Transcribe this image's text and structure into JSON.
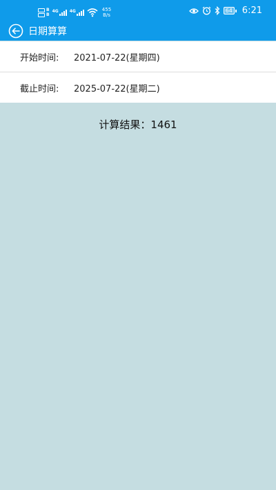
{
  "statusbar": {
    "sim1_label": "B",
    "sim2_label": "B",
    "net1_label": "4G",
    "net2_label": "4G",
    "speed_value": "455",
    "speed_unit": "B/s",
    "battery_level": "64",
    "time": "6:21",
    "icons": [
      "eye-icon",
      "alarm-icon",
      "bluetooth-icon",
      "wifi-icon",
      "battery-icon"
    ]
  },
  "appbar": {
    "title": "日期算算",
    "back_icon": "back-arrow-icon"
  },
  "form": {
    "start_label": "开始时间:",
    "start_value": "2021-07-22(星期四)",
    "end_label": "截止时间:",
    "end_value": "2025-07-22(星期二)"
  },
  "result": {
    "text": "计算结果：1461"
  },
  "colors": {
    "primary": "#0f9bea",
    "background": "#c5dde1",
    "row_background": "#ffffff"
  }
}
